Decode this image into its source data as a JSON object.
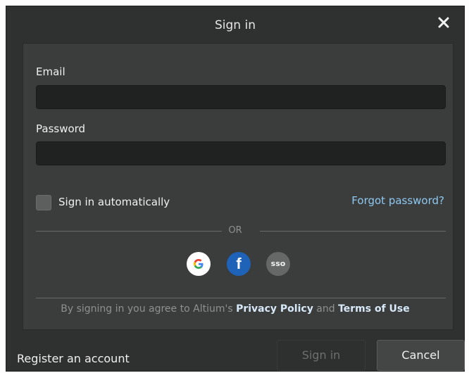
{
  "dialog": {
    "title": "Sign in",
    "email_label": "Email",
    "email_value": "",
    "password_label": "Password",
    "password_value": "",
    "auto_signin_label": "Sign in automatically",
    "auto_signin_checked": false,
    "forgot_password": "Forgot password?",
    "or_text": "OR",
    "social": {
      "google_icon": "google-icon",
      "facebook_icon": "facebook-icon",
      "sso_label": "sso"
    },
    "terms": {
      "prefix": "By signing in you agree to Altium's",
      "privacy_link": "Privacy Policy",
      "and": "and",
      "terms_link": "Terms of Use"
    }
  },
  "footer": {
    "register_label": "Register an account",
    "signin_button": "Sign in",
    "cancel_button": "Cancel"
  },
  "colors": {
    "dialog_bg": "#2f3030",
    "panel_bg": "#3b3d3d",
    "input_bg": "#202121",
    "link": "#8ec8f0",
    "facebook": "#1e63b8",
    "sso": "#666767"
  }
}
